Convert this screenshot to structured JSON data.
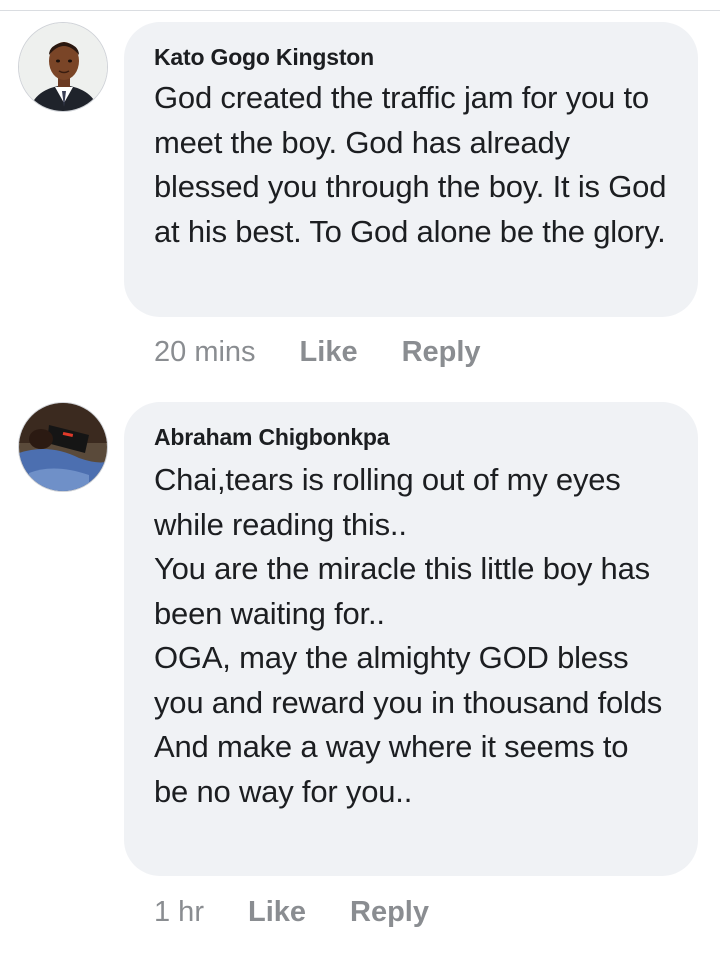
{
  "comments": [
    {
      "author": "Kato Gogo Kingston",
      "text": "God created the traffic jam for you to meet the boy. God has already blessed you through the boy. It is God at his best. To God alone be the glory.",
      "time": "20 mins",
      "like_label": "Like",
      "reply_label": "Reply"
    },
    {
      "author": "Abraham Chigbonkpa",
      "text": "Chai,tears is rolling out of my eyes while reading this..\nYou are the miracle this little boy has been waiting for..\nOGA, may the almighty GOD bless you and reward you in thousand folds\nAnd make a way where it seems to be no way for you..",
      "time": "1 hr",
      "like_label": "Like",
      "reply_label": "Reply"
    }
  ],
  "colors": {
    "bubble": "#f0f2f5",
    "meta_text": "#8a8d91",
    "body_text": "#1c1e21"
  }
}
